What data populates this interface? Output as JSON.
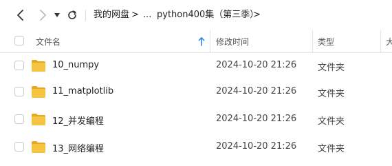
{
  "toolbar": {
    "back_icon": "chevron-left-icon",
    "forward_icon": "chevron-right-icon",
    "history_icon": "caret-down-icon",
    "refresh_icon": "refresh-icon",
    "breadcrumb": [
      {
        "label": "我的网盘"
      },
      {
        "label": "..."
      },
      {
        "label": "python400集（第三季）"
      }
    ],
    "separator": ">"
  },
  "columns": {
    "name": "文件名",
    "modified": "修改时间",
    "type": "类型",
    "size_partial": "大",
    "sort_icon": "arrow-up-icon"
  },
  "files": [
    {
      "name": "10_numpy",
      "modified": "2024-10-20 21:26",
      "type": "文件夹",
      "icon": "folder-icon"
    },
    {
      "name": "11_matplotlib",
      "modified": "2024-10-20 21:26",
      "type": "文件夹",
      "icon": "folder-icon"
    },
    {
      "name": "12_并发编程",
      "modified": "2024-10-20 21:26",
      "type": "文件夹",
      "icon": "folder-icon"
    },
    {
      "name": "13_网络编程",
      "modified": "2024-10-20 21:26",
      "type": "文件夹",
      "icon": "folder-icon"
    }
  ],
  "colors": {
    "folder": "#f5c242",
    "folder_dark": "#e6a91e",
    "sort_arrow": "#2f80ed"
  }
}
